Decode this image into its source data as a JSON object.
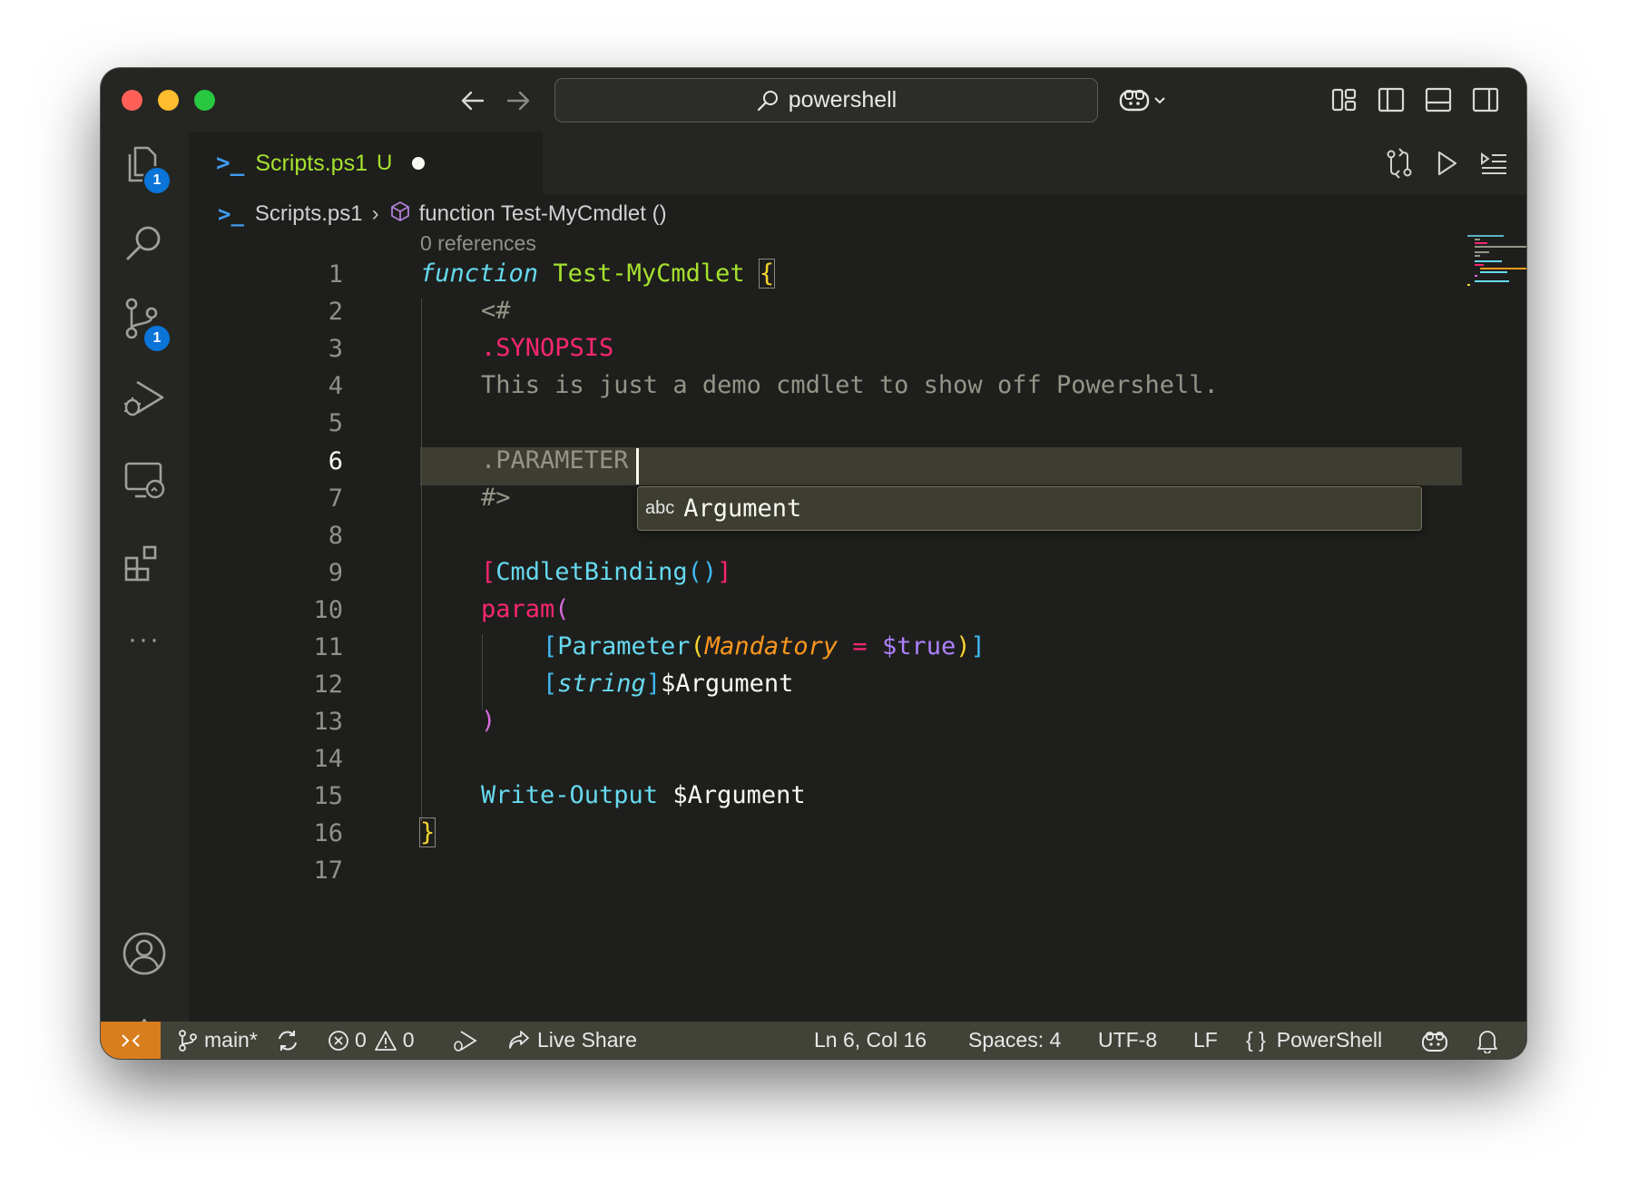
{
  "window": {
    "search_text": "powershell"
  },
  "activity_bar": {
    "explorer_badge": "1",
    "scm_badge": "1",
    "more_label": "···"
  },
  "tab": {
    "icon": ">_",
    "label": "Scripts.ps1",
    "status": "U"
  },
  "breadcrumbs": {
    "file": "Scripts.ps1",
    "symbol": "function Test-MyCmdlet ()"
  },
  "editor": {
    "codelens": "0 references",
    "line_numbers": [
      "1",
      "2",
      "3",
      "4",
      "5",
      "6",
      "7",
      "8",
      "9",
      "10",
      "11",
      "12",
      "13",
      "14",
      "15",
      "16",
      "17"
    ],
    "active_line": 6,
    "lines": {
      "l1_kw": "function",
      "l1_name": "Test-MyCmdlet",
      "l1_brace": "{",
      "l2": "<#",
      "l3": ".SYNOPSIS",
      "l4": "This is just a demo cmdlet to show off Powershell.",
      "l6": ".PARAMETER ",
      "l7": "#>",
      "l9_open": "[",
      "l9_attr": "CmdletBinding",
      "l9_parens": "()",
      "l9_close": "]",
      "l10_kw": "param",
      "l10_paren": "(",
      "l11_open": "[",
      "l11_attr": "Parameter",
      "l11_popen": "(",
      "l11_name": "Mandatory",
      "l11_eq": " = ",
      "l11_val": "$true",
      "l11_pclose": ")",
      "l11_close": "]",
      "l12_open": "[",
      "l12_type": "string",
      "l12_close": "]",
      "l12_var": "$Argument",
      "l13": ")",
      "l15_cmd": "Write-Output",
      "l15_var": " $Argument",
      "l16": "}"
    },
    "suggestion": {
      "kind": "abc",
      "label": "Argument"
    }
  },
  "status_bar": {
    "branch": "main*",
    "errors": "0",
    "warnings": "0",
    "live_share": "Live Share",
    "position": "Ln 6, Col 16",
    "spaces": "Spaces: 4",
    "encoding": "UTF-8",
    "eol": "LF",
    "language_icon": "{ }",
    "language": "PowerShell"
  },
  "colors": {
    "editor_bg": "#1e1f1c",
    "keyword": "#66d9ef",
    "function_name": "#a6e22e",
    "tag": "#f92672",
    "comment": "#949488",
    "remote_indicator": "#d97e1e"
  }
}
